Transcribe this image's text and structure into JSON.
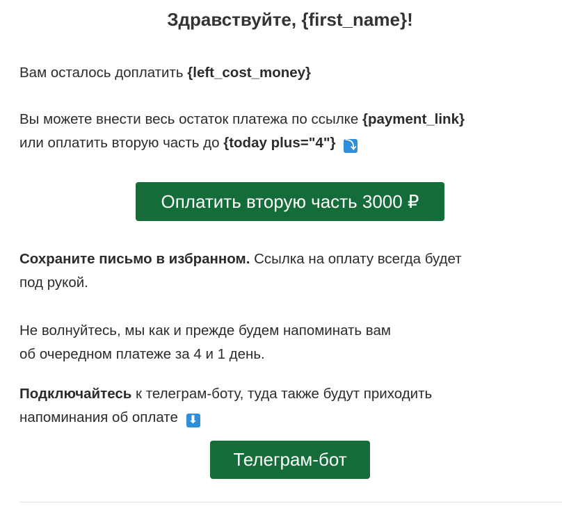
{
  "greeting": "Здравствуйте, {first_name}!",
  "balance": {
    "text": "Вам осталось доплатить ",
    "amount": "{left_cost_money}"
  },
  "payment": {
    "text1": "Вы можете внести весь остаток платежа по ссылке ",
    "link": "{payment_link}",
    "text2": "или оплатить вторую часть до ",
    "deadline": "{today plus=\"4\"}",
    "icon": "⤵"
  },
  "pay_button": "Оплатить вторую часть 3000 ₽",
  "save": {
    "bold": "Сохраните письмо в избранном.",
    "text1": " Ссылка на оплату всегда будет",
    "text2": "под рукой."
  },
  "reminder": {
    "line1": "Не волнуйтесь, мы как и прежде будем напоминать вам",
    "line2": "об очередном платеже за 4 и 1 день."
  },
  "telegram": {
    "bold": "Подключайтесь",
    "text1": " к телеграм-боту, туда также будут приходить",
    "text2": "напоминания об оплате",
    "icon": "⬇"
  },
  "telegram_button": "Телеграм-бот",
  "colors": {
    "button_bg": "#146d38",
    "emoji_bg": "#2f8fd8",
    "text": "#2b2b2b"
  }
}
